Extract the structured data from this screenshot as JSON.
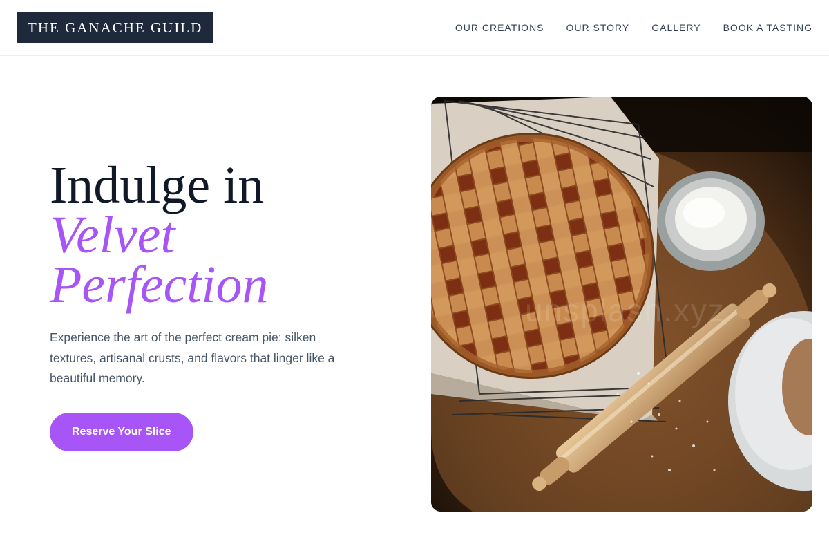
{
  "brand": {
    "name": "THE GANACHE GUILD"
  },
  "nav": {
    "items": [
      {
        "label": "OUR CREATIONS"
      },
      {
        "label": "OUR STORY"
      },
      {
        "label": "GALLERY"
      },
      {
        "label": "BOOK A TASTING"
      }
    ]
  },
  "hero": {
    "headline_line1": "Indulge in",
    "headline_accent_line1": "Velvet",
    "headline_accent_line2": "Perfection",
    "description": "Experience the art of the perfect cream pie: silken textures, artisanal crusts, and flavors that linger like a beautiful memory.",
    "cta_label": "Reserve Your Slice"
  },
  "image": {
    "subject": "lattice-pie-with-rolling-pin-and-flour",
    "watermark": "unsplash.xyz"
  },
  "colors": {
    "accent": "#a855f7",
    "brand_bg": "#1e293b",
    "heading": "#111827",
    "body_text": "#475569"
  }
}
